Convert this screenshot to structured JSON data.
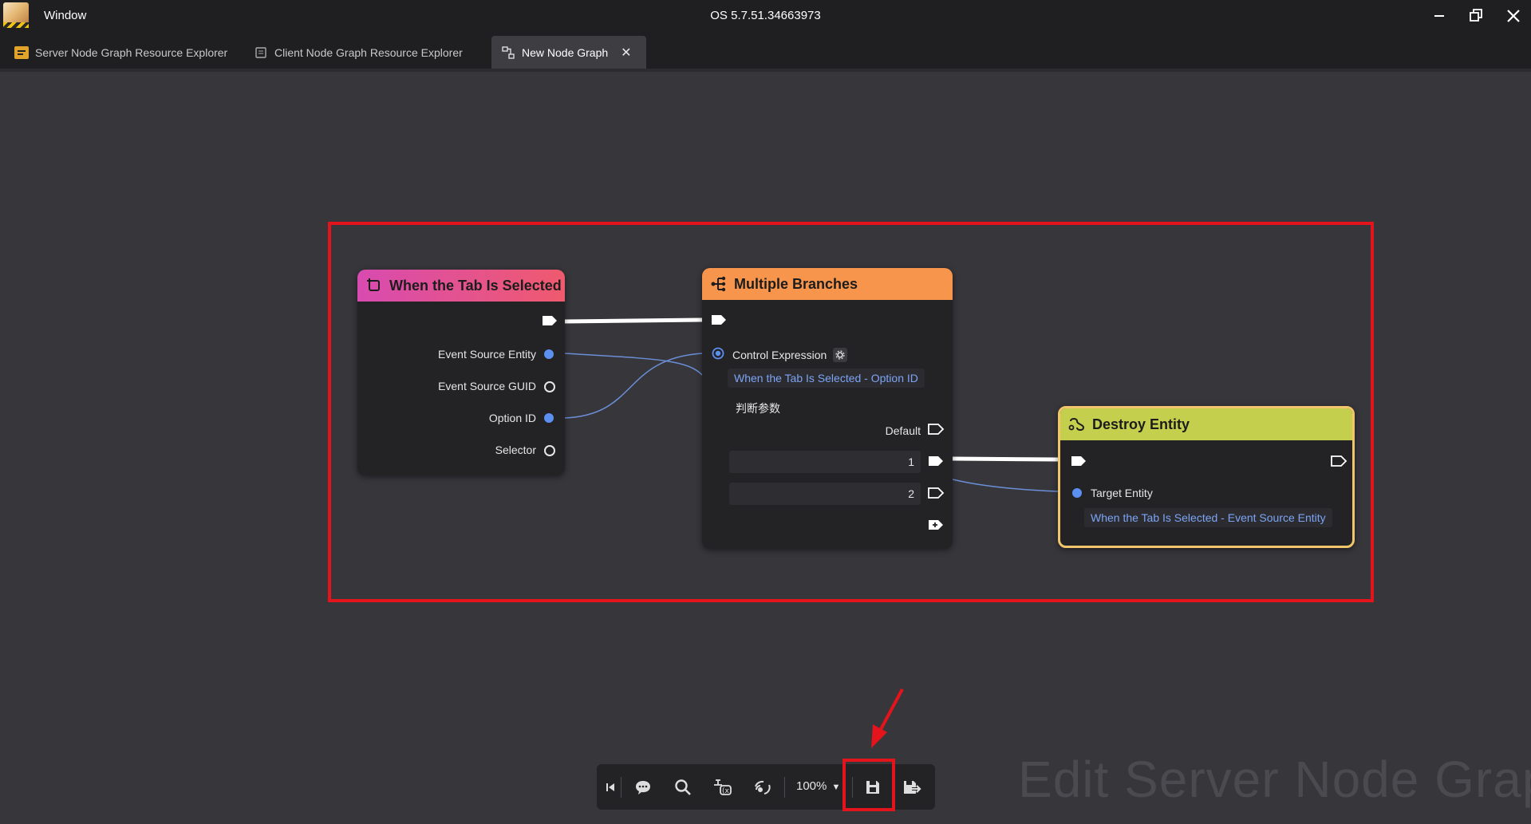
{
  "window": {
    "title": "Window",
    "build": "OS 5.7.51.34663973"
  },
  "tabs": [
    {
      "label": "Server Node Graph Resource Explorer"
    },
    {
      "label": "Client Node Graph Resource Explorer"
    },
    {
      "label": "New Node Graph",
      "close": "✕"
    }
  ],
  "nodes": {
    "tab_selected": {
      "title": "When the Tab Is Selected",
      "header_color": "#e54f8e",
      "outputs": [
        "Event Source Entity",
        "Event Source GUID",
        "Option ID",
        "Selector"
      ]
    },
    "branches": {
      "title": "Multiple Branches",
      "header_color": "#f7954c",
      "control_label": "Control Expression",
      "control_value": "When the Tab Is Selected - Option ID",
      "param_label": "判断参数",
      "default_label": "Default",
      "cases": [
        "1",
        "2"
      ]
    },
    "destroy": {
      "title": "Destroy Entity",
      "header_color": "#c5cf4e",
      "target_label": "Target Entity",
      "target_value": "When the Tab Is Selected - Event Source Entity"
    }
  },
  "toolbar": {
    "zoom": "100%"
  },
  "watermark": "Edit Server Node Graph",
  "colors": {
    "highlight": "#e3141c",
    "pin_data": "#5b8ff0",
    "link_data": "#6b8fd6"
  }
}
